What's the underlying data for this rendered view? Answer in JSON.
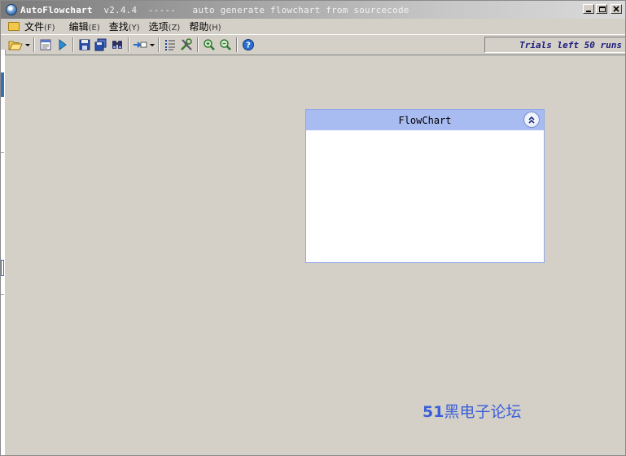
{
  "window": {
    "app_name": "AutoFlowchart",
    "title_tail": "  v2.4.4  -----   auto generate flowchart from sourcecode"
  },
  "menu": {
    "items": [
      {
        "label": "文件",
        "accel": "(F)"
      },
      {
        "label": "编辑",
        "accel": "(E)"
      },
      {
        "label": "查找",
        "accel": "(Y)"
      },
      {
        "label": "选项",
        "accel": "(Z)"
      },
      {
        "label": "帮助",
        "accel": "(H)"
      }
    ]
  },
  "toolbar": {
    "buttons": [
      "open-folder-icon",
      "dropdown-arrow-icon",
      "preview-icon",
      "run-icon",
      "save-icon",
      "save-all-icon",
      "find-binoculars-icon",
      "export-icon",
      "dropdown-arrow-icon",
      "outline-list-icon",
      "tools-icon",
      "zoom-in-icon",
      "zoom-out-icon",
      "help-icon"
    ]
  },
  "status": {
    "trials": "Trials left 50 runs"
  },
  "flowchart_panel": {
    "title": "FlowChart",
    "collapse_icon": "double-chevron-up-icon"
  },
  "watermark": {
    "number": "51",
    "text": "黑电子论坛"
  },
  "colors": {
    "panel_header": "#a9bcf2",
    "panel_border": "#8fa8e6",
    "watermark": "#3a5fd9",
    "trials_text": "#1a1a7a",
    "workspace": "#d4d0c8"
  }
}
